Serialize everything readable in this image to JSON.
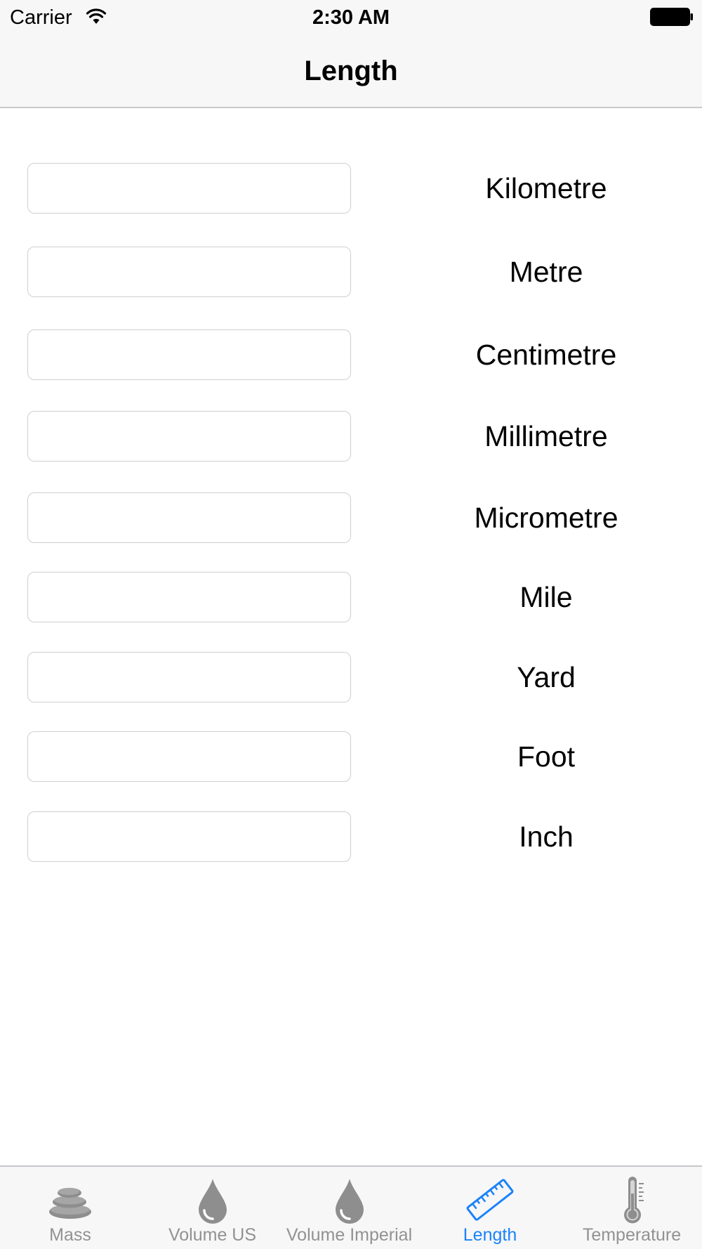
{
  "status_bar": {
    "carrier": "Carrier",
    "time": "2:30 AM",
    "wifi_icon": "wifi-icon",
    "battery_icon": "battery-icon"
  },
  "nav": {
    "title": "Length"
  },
  "units": [
    {
      "label": "Kilometre",
      "value": ""
    },
    {
      "label": "Metre",
      "value": ""
    },
    {
      "label": "Centimetre",
      "value": ""
    },
    {
      "label": "Millimetre",
      "value": ""
    },
    {
      "label": "Micrometre",
      "value": ""
    },
    {
      "label": "Mile",
      "value": ""
    },
    {
      "label": "Yard",
      "value": ""
    },
    {
      "label": "Foot",
      "value": ""
    },
    {
      "label": "Inch",
      "value": ""
    }
  ],
  "tabs": [
    {
      "label": "Mass",
      "icon": "stones-icon",
      "active": false
    },
    {
      "label": "Volume US",
      "icon": "droplet-icon",
      "active": false
    },
    {
      "label": "Volume Imperial",
      "icon": "droplet-icon",
      "active": false
    },
    {
      "label": "Length",
      "icon": "ruler-icon",
      "active": true
    },
    {
      "label": "Temperature",
      "icon": "thermometer-icon",
      "active": false
    }
  ],
  "colors": {
    "active_tab": "#1a82fb",
    "inactive_tab": "#929292",
    "bar_background": "#f7f7f7",
    "input_border": "#cfcfd4"
  }
}
